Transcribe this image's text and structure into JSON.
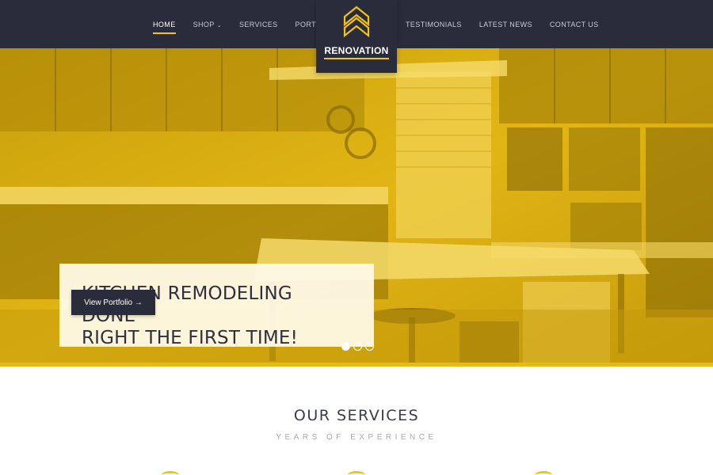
{
  "nav": {
    "left": [
      {
        "label": "HOME",
        "active": true
      },
      {
        "label": "SHOP",
        "dropdown": true
      },
      {
        "label": "SERVICES"
      },
      {
        "label": "PORTFOLIO"
      }
    ],
    "right": [
      {
        "label": "TESTIMONIALS"
      },
      {
        "label": "LATEST NEWS"
      },
      {
        "label": "CONTACT US"
      }
    ]
  },
  "logo": {
    "text": "RENOVATION",
    "icon": "chevron-up-icon"
  },
  "hero": {
    "caption_line1": "KITCHEN REMODELING DONE",
    "caption_line2": "RIGHT THE FIRST TIME!",
    "cta_label": "View Portfolio →",
    "slides": 3,
    "active_slide": 1
  },
  "services": {
    "title": "OUR SERVICES",
    "subtitle": "YEARS OF EXPERIENCE"
  },
  "colors": {
    "nav_bg": "#2a2c3c",
    "accent": "#f2c313",
    "hero_tint": "#d7ab0a"
  }
}
